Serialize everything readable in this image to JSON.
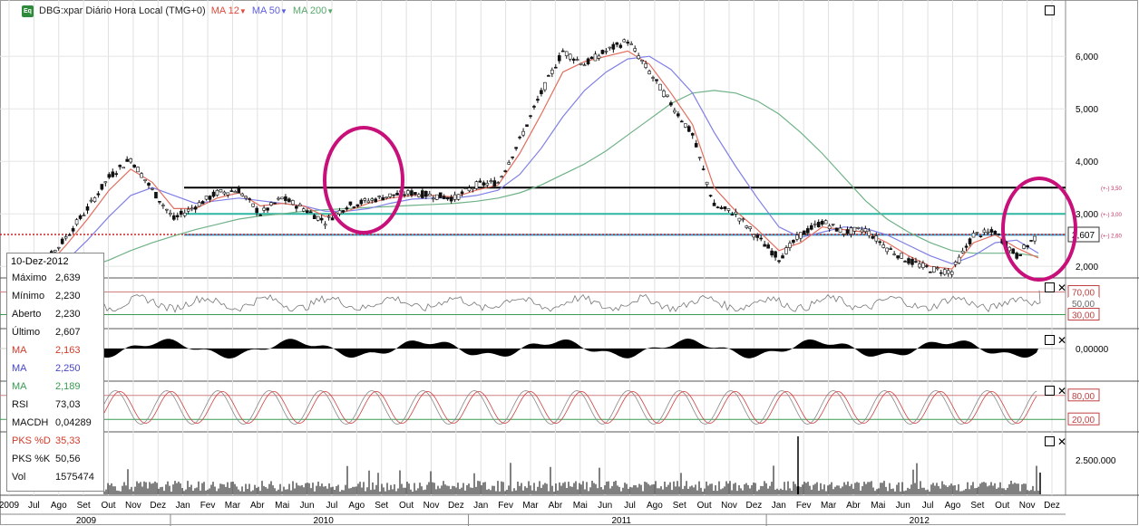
{
  "header": {
    "app_icon": "chart-app-icon",
    "title": "DBG:xpar Diário Hora Local (TMG+0)",
    "indicators": [
      {
        "label": "MA 12",
        "color": "#e04a3a"
      },
      {
        "label": "MA 50",
        "color": "#5e5ee0"
      },
      {
        "label": "MA 200",
        "color": "#56a86a"
      }
    ]
  },
  "info": {
    "date": "10-Dez-2012",
    "rows": [
      {
        "label": "Máximo",
        "value": "2,639",
        "color": "#111111"
      },
      {
        "label": "Mínimo",
        "value": "2,230",
        "color": "#111111"
      },
      {
        "label": "Aberto",
        "value": "2,230",
        "color": "#111111"
      },
      {
        "label": "Último",
        "value": "2,607",
        "color": "#111111"
      },
      {
        "label": "MA",
        "value": "2,163",
        "color": "#d23a2a"
      },
      {
        "label": "MA",
        "value": "2,250",
        "color": "#4646c8"
      },
      {
        "label": "MA",
        "value": "2,189",
        "color": "#3a9a50"
      },
      {
        "label": "RSI",
        "value": "73,03",
        "color": "#111111"
      },
      {
        "label": "MACDH",
        "value": "0,04289",
        "color": "#111111"
      },
      {
        "label": "PKS %D",
        "value": "35,33",
        "color": "#d23a2a"
      },
      {
        "label": "PKS %K",
        "value": "50,56",
        "color": "#111111"
      },
      {
        "label": "Vol",
        "value": "1575474",
        "color": "#111111"
      }
    ]
  },
  "chart_data": {
    "type": "line",
    "price_axis": {
      "ticks": [
        "2,000",
        "3,000",
        "4,000",
        "5,000",
        "6,000"
      ],
      "ylim": [
        1.9,
        6.9
      ]
    },
    "last_price_label": "2,607",
    "price_series": {
      "x": [
        "2009-01",
        "2009-02",
        "2009-03",
        "2009-04",
        "2009-05",
        "2009-06",
        "2009-07",
        "2009-08",
        "2009-09",
        "2009-10",
        "2009-11",
        "2009-12",
        "2010-01",
        "2010-02",
        "2010-03",
        "2010-04",
        "2010-05",
        "2010-06",
        "2010-07",
        "2010-08",
        "2010-09",
        "2010-10",
        "2010-11",
        "2010-12",
        "2011-01",
        "2011-02",
        "2011-03",
        "2011-04",
        "2011-05",
        "2011-06",
        "2011-07",
        "2011-08",
        "2011-09",
        "2011-10",
        "2011-11",
        "2011-12",
        "2012-01",
        "2012-02",
        "2012-03",
        "2012-04",
        "2012-05",
        "2012-06",
        "2012-07",
        "2012-08",
        "2012-09",
        "2012-10",
        "2012-11",
        "2012-12"
      ],
      "close": [
        1.8,
        2.05,
        2.55,
        3.1,
        3.7,
        4.05,
        3.45,
        2.9,
        3.15,
        3.4,
        3.45,
        3.0,
        3.3,
        3.1,
        2.85,
        3.15,
        3.25,
        3.35,
        3.4,
        3.35,
        3.3,
        3.55,
        3.6,
        4.4,
        5.3,
        6.1,
        5.85,
        6.1,
        6.3,
        5.7,
        5.1,
        4.5,
        3.15,
        3.0,
        2.55,
        2.15,
        2.6,
        2.85,
        2.65,
        2.7,
        2.35,
        2.1,
        1.95,
        1.9,
        2.6,
        2.65,
        2.2,
        2.61
      ],
      "ma12": [
        1.75,
        1.95,
        2.4,
        2.9,
        3.45,
        3.85,
        3.6,
        3.1,
        3.1,
        3.3,
        3.4,
        3.15,
        3.2,
        3.15,
        2.95,
        3.05,
        3.2,
        3.3,
        3.35,
        3.35,
        3.32,
        3.45,
        3.55,
        4.15,
        4.9,
        5.7,
        5.9,
        6.0,
        6.1,
        5.85,
        5.3,
        4.7,
        3.5,
        3.05,
        2.7,
        2.3,
        2.45,
        2.75,
        2.7,
        2.65,
        2.45,
        2.2,
        2.0,
        1.95,
        2.45,
        2.6,
        2.35,
        2.16
      ],
      "ma50": [
        1.8,
        1.85,
        2.1,
        2.5,
        2.95,
        3.35,
        3.5,
        3.35,
        3.2,
        3.25,
        3.3,
        3.25,
        3.2,
        3.15,
        3.05,
        3.05,
        3.1,
        3.2,
        3.28,
        3.3,
        3.3,
        3.35,
        3.45,
        3.75,
        4.25,
        4.85,
        5.35,
        5.7,
        5.95,
        6.0,
        5.75,
        5.3,
        4.55,
        3.9,
        3.3,
        2.75,
        2.55,
        2.65,
        2.75,
        2.72,
        2.6,
        2.4,
        2.2,
        2.05,
        2.2,
        2.45,
        2.5,
        2.25
      ],
      "ma200": [
        1.8,
        1.82,
        1.88,
        1.98,
        2.12,
        2.3,
        2.45,
        2.58,
        2.7,
        2.8,
        2.9,
        2.96,
        3.0,
        3.05,
        3.08,
        3.1,
        3.12,
        3.14,
        3.16,
        3.18,
        3.2,
        3.24,
        3.3,
        3.4,
        3.55,
        3.75,
        3.95,
        4.2,
        4.5,
        4.8,
        5.1,
        5.3,
        5.35,
        5.3,
        5.15,
        4.9,
        4.55,
        4.15,
        3.7,
        3.25,
        2.9,
        2.65,
        2.45,
        2.3,
        2.25,
        2.25,
        2.25,
        2.19
      ]
    },
    "horizontal_levels": [
      {
        "price": 3.5,
        "label": "(+-) 3,50",
        "color": "#000000"
      },
      {
        "price": 3.0,
        "label": "(+-) 3,00",
        "color": "#2fb6a2"
      },
      {
        "price": 2.6,
        "label": "(+-) 2,60",
        "color": "#2a9ed4"
      },
      {
        "price": 2.607,
        "label": "",
        "color": "#cc2222",
        "style": "dotted"
      }
    ],
    "rsi": {
      "levels": [
        "70,00",
        "50,00",
        "30,00"
      ],
      "last": 73.03
    },
    "macd_hist": {
      "axis_label": "0,00000",
      "last": 0.04289
    },
    "stochastic": {
      "levels": [
        "80,00",
        "20,00"
      ],
      "pks_d": 35.33,
      "pks_k": 50.56
    },
    "volume": {
      "axis_label": "2.500.000",
      "last": 1575474
    },
    "x_axis": {
      "months": [
        "2009",
        "Jul",
        "Ago",
        "Set",
        "Out",
        "Nov",
        "Dez",
        "Jan",
        "Fev",
        "Mar",
        "Abr",
        "Mai",
        "Jun",
        "Jul",
        "Ago",
        "Set",
        "Out",
        "Nov",
        "Dez",
        "Jan",
        "Fev",
        "Mar",
        "Abr",
        "Mai",
        "Jun",
        "Jul",
        "Ago",
        "Set",
        "Out",
        "Nov",
        "Dez",
        "Jan",
        "Fev",
        "Mar",
        "Abr",
        "Mai",
        "Jun",
        "Jul",
        "Ago",
        "Set",
        "Out",
        "Nov",
        "Dez"
      ],
      "years": [
        "2009",
        "2010",
        "2011",
        "2012"
      ]
    }
  }
}
